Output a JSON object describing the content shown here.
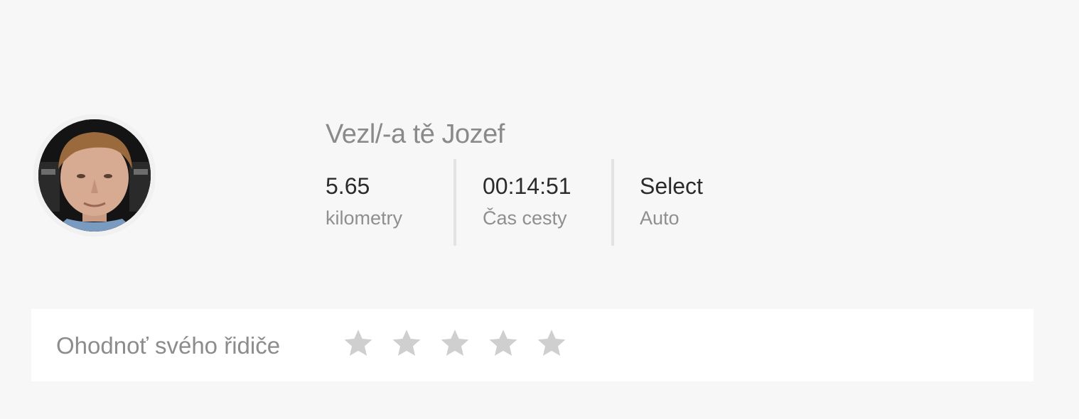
{
  "driver": {
    "title": "Vezl/-a tě Jozef",
    "avatar_icon": "driver-photo"
  },
  "stats": [
    {
      "value": "5.65",
      "label": "kilometry"
    },
    {
      "value": "00:14:51",
      "label": "Čas cesty"
    },
    {
      "value": "Select",
      "label": "Auto"
    }
  ],
  "rating": {
    "label": "Ohodnoť svého řidiče",
    "max_stars": 5,
    "selected_stars": 0,
    "star_icon": "star-icon",
    "star_color": "#cfcfcf"
  }
}
